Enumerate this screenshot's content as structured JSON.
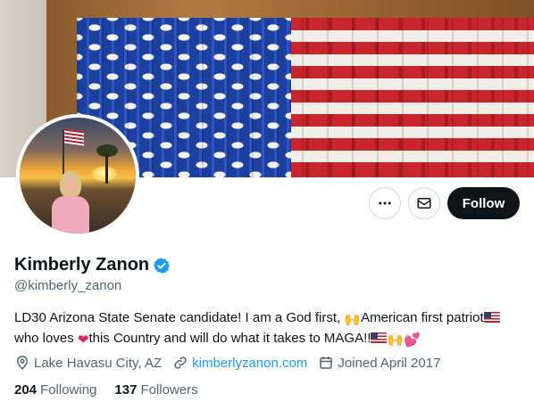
{
  "profile": {
    "name": "Kimberly Zanon",
    "handle": "@kimberly_zanon",
    "verified": true,
    "bio": {
      "part1": "LD30 Arizona State Senate candidate! I am a God first, ",
      "part2": "American first patriot",
      "part3": "who loves ",
      "part4": "this Country and will do what it takes to MAGA!!"
    },
    "location": "Lake Havasu City, AZ",
    "website": "kimberlyzanon.com",
    "joined": "Joined April 2017",
    "following_count": "204",
    "following_label": "Following",
    "followers_count": "137",
    "followers_label": "Followers"
  },
  "actions": {
    "follow_label": "Follow",
    "more_icon": "more-horizontal-icon",
    "message_icon": "envelope-icon"
  },
  "colors": {
    "accent": "#1d9bf0",
    "primary_button": "#0f1419",
    "secondary_text": "#536471"
  },
  "emoji": {
    "praying_hands": "🙌",
    "red_heart": "❤",
    "sparkle_heart": "💕"
  }
}
